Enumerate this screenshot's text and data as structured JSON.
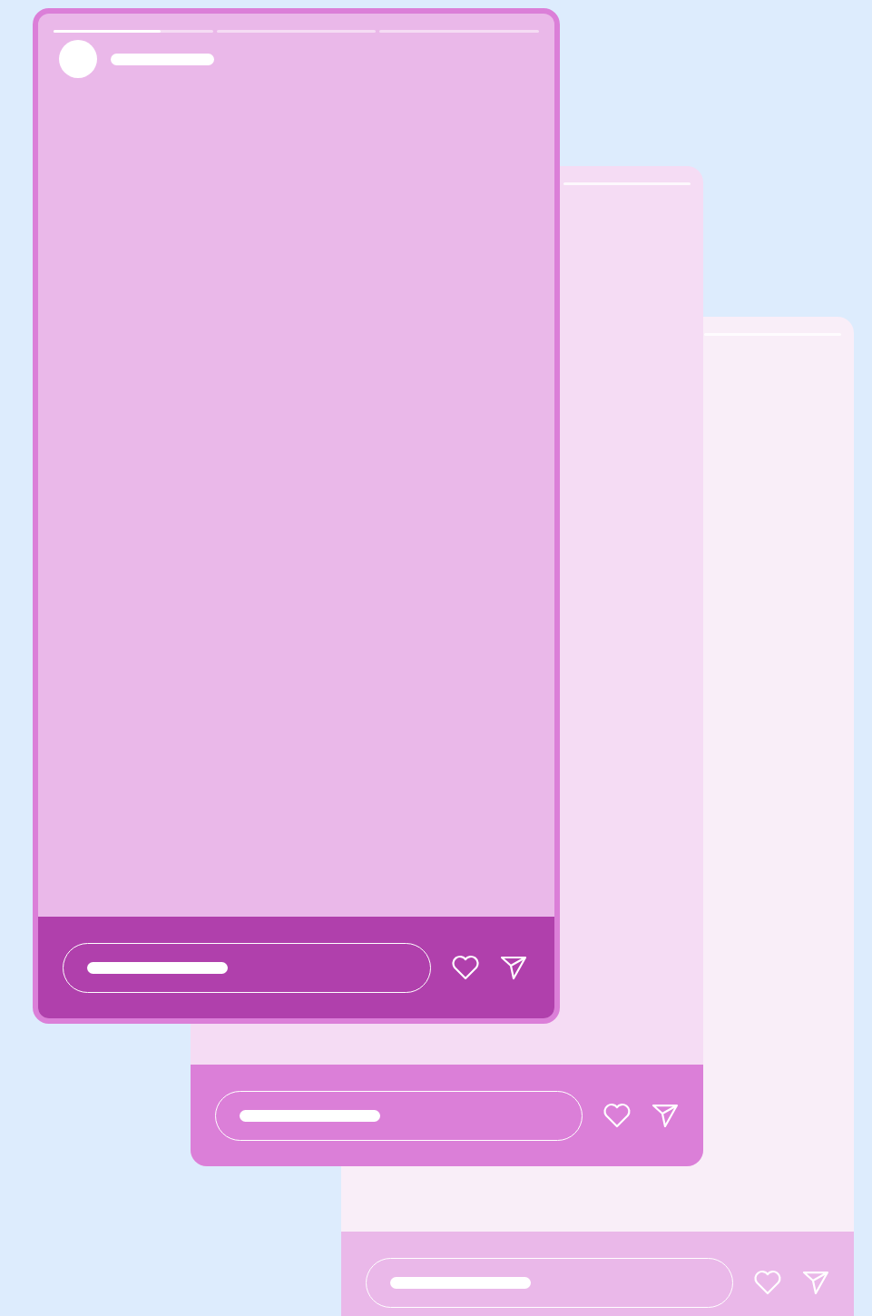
{
  "stories": [
    {
      "kind": "active",
      "progress": {
        "level": 0.67
      }
    },
    {
      "kind": "stacked"
    },
    {
      "kind": "stacked"
    }
  ]
}
